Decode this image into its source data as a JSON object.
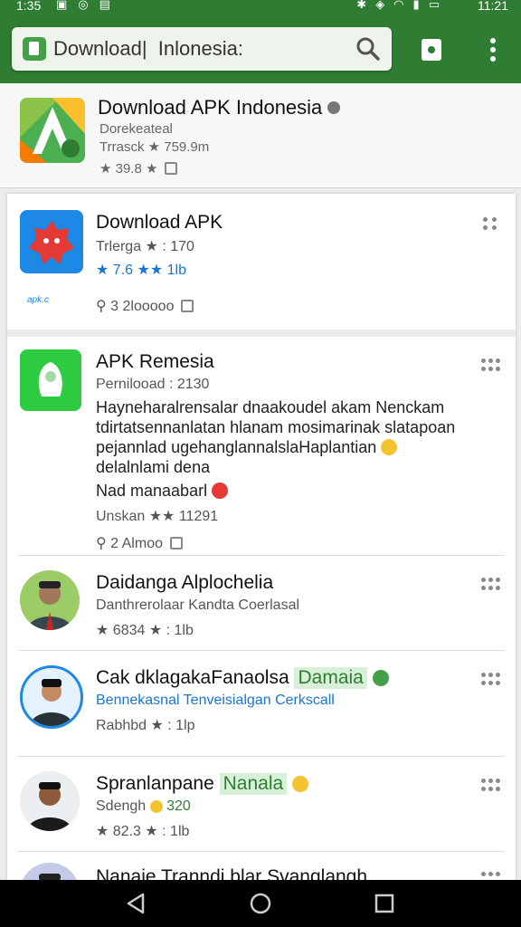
{
  "status": {
    "time_left": "1:35",
    "time_right": "11:21"
  },
  "search": {
    "value": "Download|  Inlonesia:"
  },
  "featured": {
    "title": "Download APK Indonesia",
    "line1": "Dorekeateal",
    "line2": "Trrasck ★ 759.9m",
    "line3": "★ 39.8 ★"
  },
  "rows": [
    {
      "title": "Download APK",
      "meta1": "Trlerga ★ : 170",
      "meta2": "★ 7.6 ★★  1lb",
      "meta3": "3 2looooo",
      "logo_text": "apk.c"
    },
    {
      "title": "APK Remesia",
      "meta1": "Pernilooad : 2130",
      "desc1": "Hayneharalrensalar dnaakoudel akam Nenckam",
      "desc2": "tdirtatsennanlatan hlanam mosimarinak slatapoan",
      "desc3": "pejannlad ugehanglannalslaHaplantian",
      "desc4": "delalnlami dena",
      "desc5": "Nad manaabarl",
      "meta2": "Unskan ★★ 11291",
      "meta3": "2 Almoo"
    },
    {
      "title": "Daidanga Alplochelia",
      "meta1": "Danthrerolaar Kandta Coerlasal",
      "meta2": "★ 6834 ★ :  1lb"
    },
    {
      "title": "Cak dklagakaFanaolsa",
      "tag": "Damaia",
      "meta1": "Bennekasnal Tenveisialgan Cerkscall",
      "meta2": "Rabhbd ★ :  1lp"
    },
    {
      "title": "Spranlanpane",
      "tag": "Nanala",
      "meta1": "Sdengh",
      "meta1b": "320",
      "meta2": "★ 82.3 ★ :  1lb"
    },
    {
      "title": "Nanaie Tranndi blar Svanglangh"
    }
  ]
}
